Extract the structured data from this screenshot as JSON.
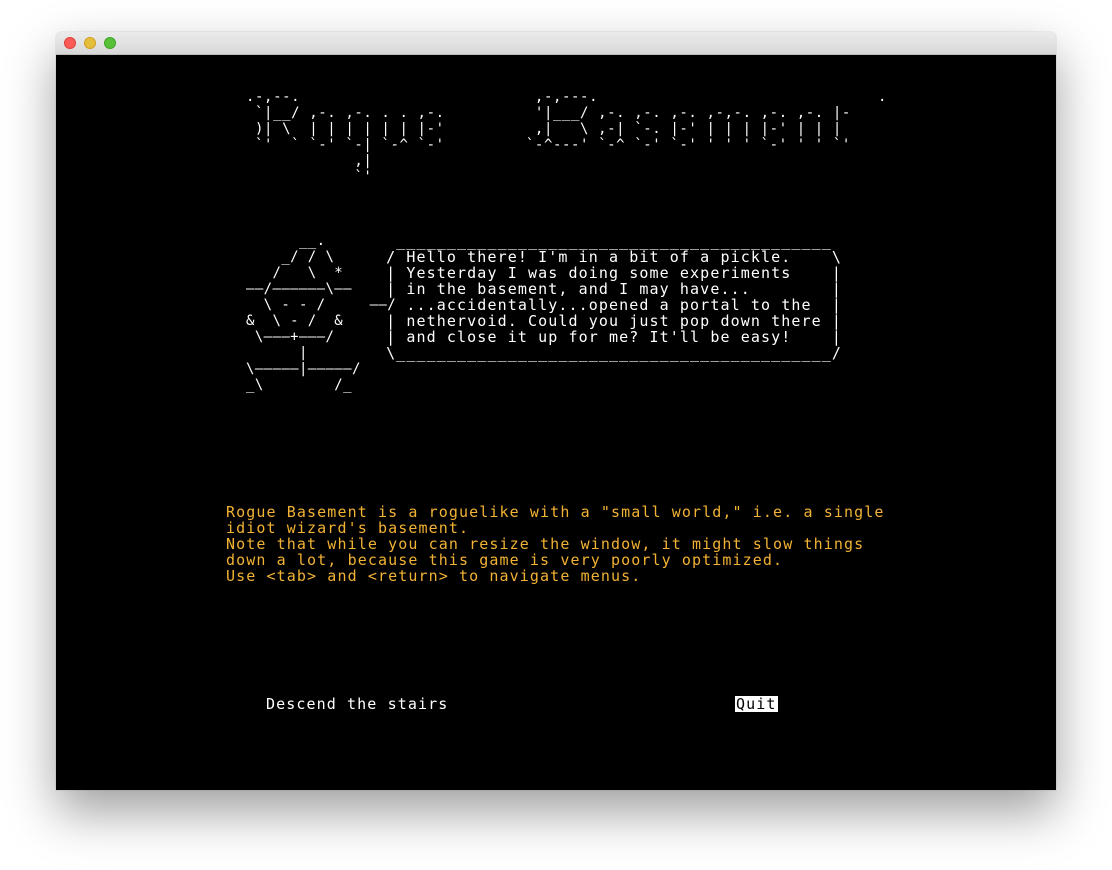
{
  "window": {
    "controls": [
      "close-button",
      "minimize-button",
      "zoom-button"
    ]
  },
  "logo_art": [
    ".-,--.                          ,-,---.                               .",
    " `|__/ ,-. ,-. . . ,-.          '|___/ ,-. ,-. ,-. ,-,-. ,-. ,-. |-",
    " )| \\  | | | | | | |-'          ,|   \\ ,-| `-. |-' | | | |-' | | |",
    " `'  ` `-' `-| `-^ `-'         `-^---' `-^ `-' `-' ' ' ' `-' ' ' `'",
    "            ,|",
    "            `'"
  ],
  "wizard_art": [
    "      __.",
    "    _/ / \\",
    "   /   \\  *",
    "——/——————\\——",
    "  \\ - - /     ——/",
    "&  \\ - /  &",
    " \\———+———/",
    "      |",
    "\\—————|—————/",
    "_\\        /_"
  ],
  "speech_bubble": [
    "  ___________________________________________",
    " / Hello there! I'm in a bit of a pickle.    \\",
    " | Yesterday I was doing some experiments    |",
    " | in the basement, and I may have...        |",
    "   ...accidentally...opened a portal to the  |",
    " | nethervoid. Could you just pop down there |",
    " | and close it up for me? It'll be easy!    |",
    " \\___________________________________________/"
  ],
  "intro": {
    "p1": "Rogue Basement is a roguelike with a \"small world,\" i.e. a single\nidiot wizard's basement.",
    "p2": "Note that while you can resize the window, it might slow things\ndown a lot, because this game is very poorly optimized.",
    "p3": "Use <tab> and <return> to navigate menus."
  },
  "menu": {
    "descend_label": "Descend the stairs",
    "quit_label": "Quit",
    "selected": "Quit"
  },
  "colors": {
    "background": "#000000",
    "text_white": "#ffffff",
    "text_accent": "#f2b233"
  }
}
